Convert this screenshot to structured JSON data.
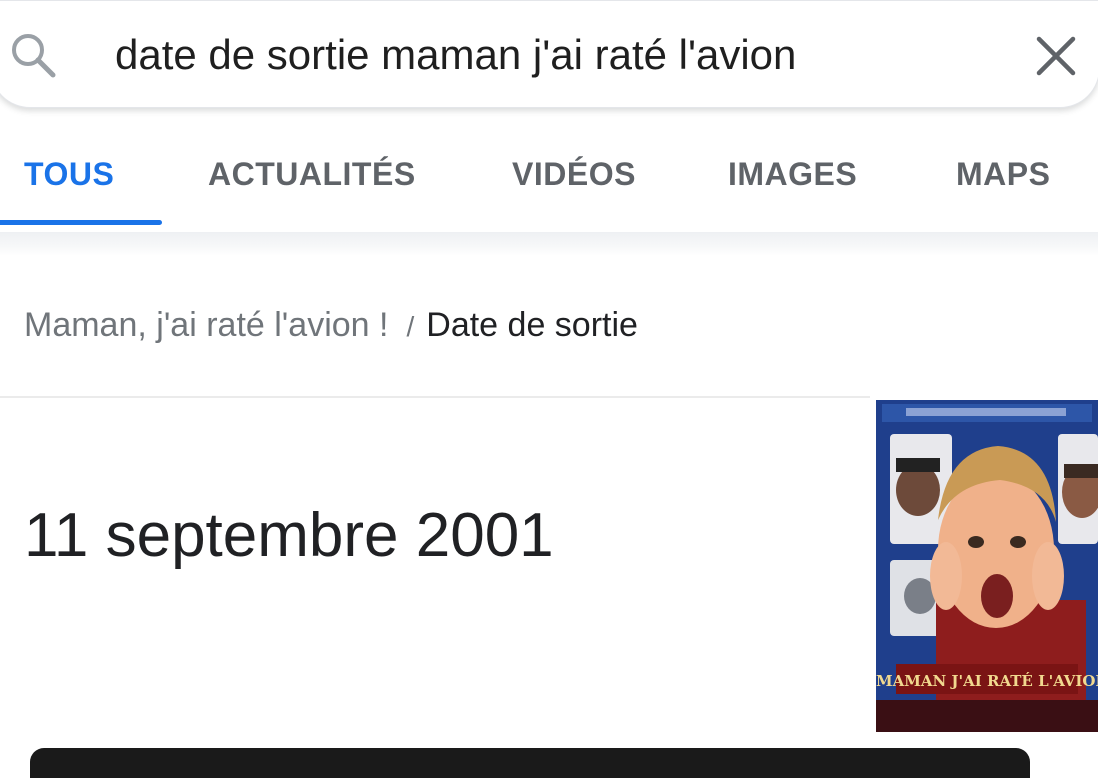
{
  "search": {
    "query": "date de sortie maman j'ai raté l'avion"
  },
  "tabs": [
    {
      "label": "TOUS",
      "active": true
    },
    {
      "label": "ACTUALITÉS",
      "active": false
    },
    {
      "label": "VIDÉOS",
      "active": false
    },
    {
      "label": "IMAGES",
      "active": false
    },
    {
      "label": "MAPS",
      "active": false
    }
  ],
  "breadcrumb": {
    "parent": "Maman, j'ai raté l'avion !",
    "separator": "/",
    "current": "Date de sortie"
  },
  "answer": {
    "value": "11 septembre 2001"
  },
  "poster": {
    "caption": "MAMAN J'AI RATÉ L'AVION"
  },
  "icons": {
    "search": "search-icon",
    "clear": "close-icon"
  },
  "colors": {
    "accent": "#1a73e8",
    "tab_inactive": "#5f6368",
    "secondary_text": "#70757a",
    "primary_text": "#202124"
  }
}
